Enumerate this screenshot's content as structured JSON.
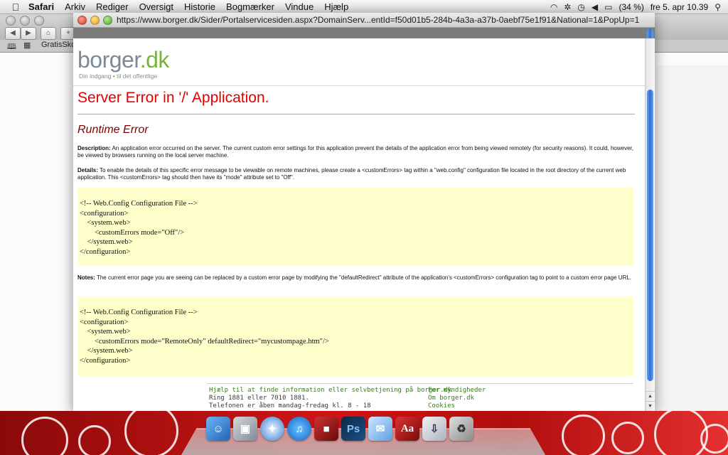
{
  "menubar": {
    "apple_icon": "apple-icon",
    "items": [
      "Safari",
      "Arkiv",
      "Rediger",
      "Oversigt",
      "Historie",
      "Bogmærker",
      "Vindue",
      "Hjælp"
    ],
    "battery": "(34 %)",
    "clock": "fre 5. apr  10.39"
  },
  "browser": {
    "bookmark": "GratisSkol"
  },
  "popup": {
    "url": "https://www.borger.dk/Sider/Portalservicesiden.aspx?DomainServ...entId=f50d01b5-284b-4a3a-a37b-0aebf75e1f91&National=1&PopUp=1"
  },
  "logo": {
    "name_part1": "borger",
    "name_part2": ".dk",
    "tag_part1": "Din indgang",
    "tag_part2": "til det offentlige"
  },
  "error": {
    "title": "Server Error in '/' Application.",
    "subtitle": "Runtime Error",
    "description_label": "Description:",
    "description_text": "An application error occurred on the server. The current custom error settings for this application prevent the details of the application error from being viewed remotely (for security reasons). It could, however, be viewed by browsers running on the local server machine.",
    "details_label": "Details:",
    "details_text": "To enable the details of this specific error message to be viewable on remote machines, please create a <customErrors> tag within a \"web.config\" configuration file located in the root directory of the current web application. This <customErrors> tag should then have its \"mode\" attribute set to \"Off\".",
    "code1": [
      "<!-- Web.Config Configuration File -->",
      "",
      "<configuration>",
      "    <system.web>",
      "        <customErrors mode=\"Off\"/>",
      "    </system.web>",
      "</configuration>"
    ],
    "notes_label": "Notes:",
    "notes_text": "The current error page you are seeing can be replaced by a custom error page by modifying the \"defaultRedirect\" attribute of the application's <customErrors> configuration tag to point to a custom error page URL.",
    "code2": [
      "<!-- Web.Config Configuration File -->",
      "",
      "<configuration>",
      "    <system.web>",
      "        <customErrors mode=\"RemoteOnly\" defaultRedirect=\"mycustompage.htm\"/>",
      "    </system.web>",
      "</configuration>"
    ]
  },
  "footer": {
    "help_link": "Hjælp til at finde information eller selvbetjening på borger.dk",
    "phone": "Ring 1881 eller 7010 1881.",
    "hours": "Telefonen er åben mandag-fredag kl. 8 - 18",
    "links": [
      "For myndigheder",
      "Om borger.dk",
      "Cookies"
    ]
  },
  "dock": {
    "icons": [
      "finder-icon",
      "preview-icon",
      "safari-icon",
      "itunes-icon",
      "photo-booth-icon",
      "photoshop-icon",
      "mail-icon",
      "dictionary-icon",
      "downloads-icon",
      "trash-icon"
    ],
    "photoshop_label": "Ps",
    "dictionary_label": "Aa"
  },
  "colors": {
    "error_red": "#e40000",
    "runtime_red": "#7d0000",
    "code_bg": "#ffffcc",
    "brand_green": "#76b43a",
    "brand_grey": "#7a8a96"
  }
}
